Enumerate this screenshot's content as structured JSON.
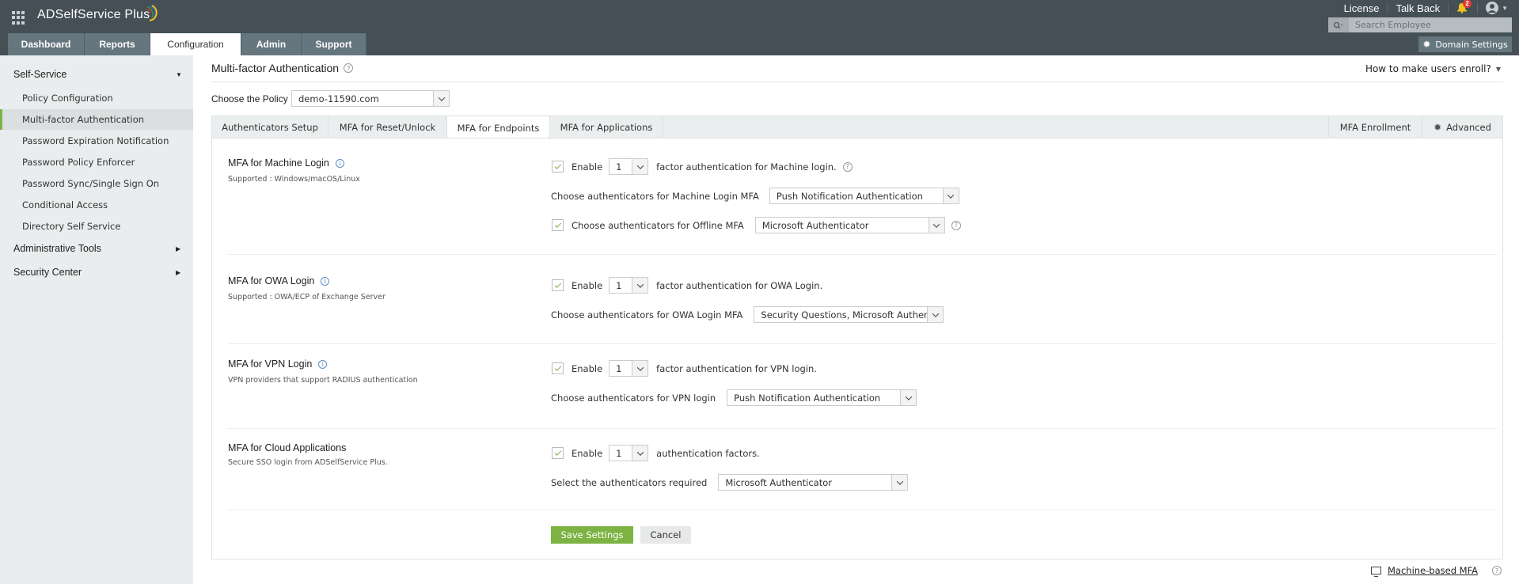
{
  "app": {
    "name": "ADSelfService Plus",
    "nav_tabs": [
      "Dashboard",
      "Reports",
      "Configuration",
      "Admin",
      "Support"
    ],
    "active_tab": "Configuration",
    "top_links": {
      "license": "License",
      "talk_back": "Talk Back",
      "notification_count": "2"
    },
    "search": {
      "placeholder": "Search Employee",
      "value": ""
    },
    "domain_settings": "Domain Settings"
  },
  "sidebar": {
    "groups": [
      {
        "label": "Self-Service",
        "expanded": true,
        "items": [
          {
            "label": "Policy Configuration"
          },
          {
            "label": "Multi-factor Authentication",
            "active": true
          },
          {
            "label": "Password Expiration Notification"
          },
          {
            "label": "Password Policy Enforcer"
          },
          {
            "label": "Password Sync/Single Sign On"
          },
          {
            "label": "Conditional Access"
          },
          {
            "label": "Directory Self Service"
          }
        ]
      },
      {
        "label": "Administrative Tools",
        "expanded": false
      },
      {
        "label": "Security Center",
        "expanded": false
      }
    ]
  },
  "main": {
    "title": "Multi-factor Authentication",
    "enroll_help": "How to make users enroll?",
    "policy_label": "Choose the Policy",
    "policy_value": "demo-11590.com",
    "tabs": [
      {
        "label": "Authenticators Setup"
      },
      {
        "label": "MFA for Reset/Unlock"
      },
      {
        "label": "MFA for Endpoints",
        "active": true
      },
      {
        "label": "MFA for Applications"
      }
    ],
    "right_tabs": [
      {
        "label": "MFA Enrollment"
      },
      {
        "label": "Advanced"
      }
    ],
    "sections": [
      {
        "title": "MFA for Machine Login",
        "subtitle": "Supported : Windows/macOS/Linux",
        "enable_label": "Enable",
        "enabled": true,
        "factor_count": "1",
        "factor_text": "factor authentication for Machine login.",
        "choose_label": "Choose authenticators for Machine Login MFA",
        "choose_value": "Push Notification Authentication",
        "offline_label": "Choose authenticators for Offline MFA",
        "offline_enabled": true,
        "offline_value": "Microsoft Authenticator"
      },
      {
        "title": "MFA for OWA Login",
        "subtitle": "Supported : OWA/ECP of Exchange Server",
        "enable_label": "Enable",
        "enabled": true,
        "factor_count": "1",
        "factor_text": "factor authentication for OWA Login.",
        "choose_label": "Choose authenticators for OWA Login MFA",
        "choose_value": "Security Questions, Microsoft Authenticator"
      },
      {
        "title": "MFA for VPN Login",
        "subtitle": "VPN providers that support RADIUS authentication",
        "enable_label": "Enable",
        "enabled": true,
        "factor_count": "1",
        "factor_text": "factor authentication for VPN login.",
        "choose_label": "Choose authenticators for VPN login",
        "choose_value": "Push Notification Authentication"
      },
      {
        "title": "MFA for Cloud Applications",
        "subtitle": "Secure SSO login from ADSelfService Plus.",
        "enable_label": "Enable",
        "enabled": true,
        "factor_count": "1",
        "factor_text": "authentication factors.",
        "choose_label": "Select the authenticators required",
        "choose_value": "Microsoft Authenticator"
      }
    ],
    "save_label": "Save Settings",
    "cancel_label": "Cancel",
    "machine_mfa_link": "Machine-based MFA"
  },
  "colors": {
    "header": "#444f56",
    "accent_green": "#7cb342",
    "nav_tab": "#66767f",
    "sidebar": "#e9edee"
  }
}
